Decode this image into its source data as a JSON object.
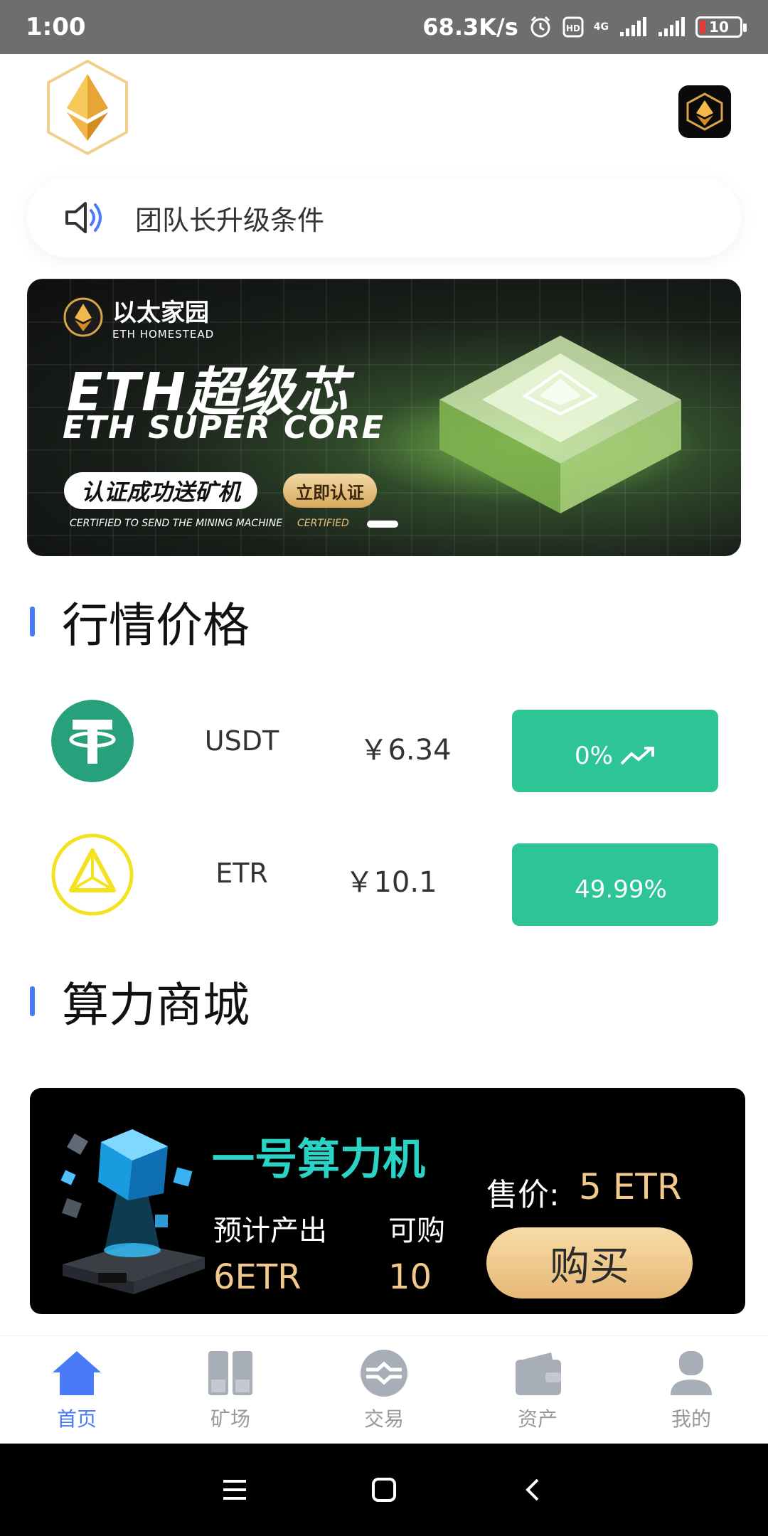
{
  "status_bar": {
    "time": "1:00",
    "speed": "68.3K/s",
    "network": "4G",
    "battery": "10"
  },
  "notice": {
    "text": "团队长升级条件"
  },
  "banner": {
    "brand_cn": "以太家园",
    "brand_en": "ETH HOMESTEAD",
    "title": "ETH超级芯",
    "subtitle": "ETH SUPER CORE",
    "pill": "认证成功送矿机",
    "gold_button": "立即认证",
    "caption": "CERTIFIED TO SEND THE MINING MACHINE",
    "caption_tag": "CERTIFIED"
  },
  "market": {
    "title": "行情价格",
    "rows": [
      {
        "name": "USDT",
        "price": "￥6.34",
        "change": "0%",
        "icon": "tether-icon",
        "trend": "trending-up-icon"
      },
      {
        "name": "ETR",
        "price": "￥10.1",
        "change": "49.99%",
        "icon": "etr-triangle-icon",
        "trend": ""
      }
    ]
  },
  "shop": {
    "title": "算力商城",
    "product": {
      "name": "一号算力机",
      "output_label": "预计产出",
      "output_value": "6ETR",
      "available_label": "可购",
      "available_value": "10",
      "price_label": "售价:",
      "price": "5 ETR",
      "buy_label": "购买"
    }
  },
  "tabbar": {
    "items": [
      {
        "label": "首页",
        "icon": "home-icon",
        "active": true
      },
      {
        "label": "矿场",
        "icon": "mine-icon",
        "active": false
      },
      {
        "label": "交易",
        "icon": "trade-icon",
        "active": false
      },
      {
        "label": "资产",
        "icon": "wallet-icon",
        "active": false
      },
      {
        "label": "我的",
        "icon": "profile-icon",
        "active": false
      }
    ]
  },
  "colors": {
    "accent": "#4a7bf7",
    "green": "#2dc596",
    "gold": "#f2c98a",
    "teal": "#2ad3c5"
  }
}
